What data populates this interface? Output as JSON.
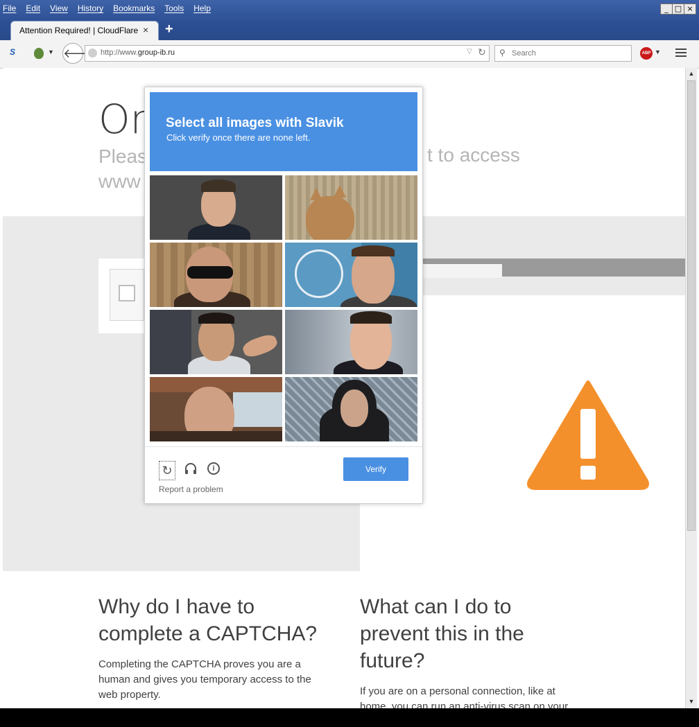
{
  "menu": [
    "File",
    "Edit",
    "View",
    "History",
    "Bookmarks",
    "Tools",
    "Help"
  ],
  "window_buttons": [
    "_",
    "□",
    "×"
  ],
  "tab": {
    "title": "Attention Required! | CloudFlare",
    "close": "×",
    "new_tab": "+"
  },
  "address": {
    "prefix": "http://www.",
    "domain": "group-ib.ru"
  },
  "search": {
    "placeholder": "Search"
  },
  "addons": {
    "abp": "ABP"
  },
  "page": {
    "heading_partial": "On",
    "subtitle_line1": "Pleas",
    "subtitle_line1_right": "t to access",
    "subtitle_line2": "www",
    "why_heading": "Why do I have to complete a CAPTCHA?",
    "why_body": "Completing the CAPTCHA proves you are a human and gives you temporary access to the web property.",
    "what_heading": "What can I do to prevent this in the future?",
    "what_body": "If you are on a personal connection, like at home, you can run an anti-virus scan on your"
  },
  "captcha": {
    "title": "Select all images with Slavik",
    "subtitle": "Click verify once there are none left.",
    "verify_label": "Verify",
    "report_label": "Report a problem",
    "tile_count": 8,
    "tile_colors": {
      "t1": "#4a4a4a",
      "t2": "#b8a88a",
      "t3": "#a8865e",
      "t4": "#3f7fa8",
      "t5": "#5a5a5a",
      "t6": "#9aa3ad",
      "t7": "#6b4a36",
      "t8": "#8a9aa8"
    }
  },
  "colors": {
    "captcha_blue": "#4a90e2",
    "warning_orange": "#f4902c"
  }
}
